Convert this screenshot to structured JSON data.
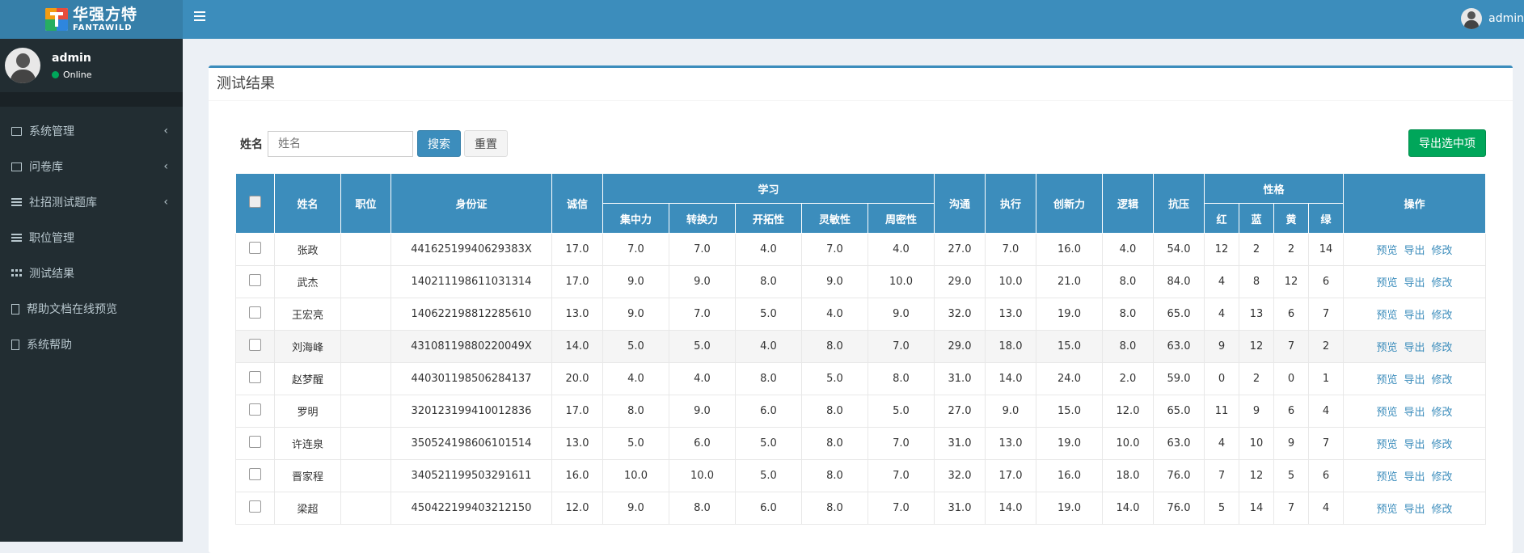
{
  "app": {
    "logo_cn": "华强方特",
    "logo_en": "FANTAWILD"
  },
  "header": {
    "username": "admin"
  },
  "sidebar": {
    "user": {
      "name": "admin",
      "status": "Online"
    },
    "items": [
      {
        "label": "系统管理",
        "icon": "edit-icon",
        "has_children": true
      },
      {
        "label": "问卷库",
        "icon": "book-icon",
        "has_children": true
      },
      {
        "label": "社招测试题库",
        "icon": "list-icon",
        "has_children": true
      },
      {
        "label": "职位管理",
        "icon": "list-icon",
        "has_children": false
      },
      {
        "label": "测试结果",
        "icon": "grid-icon",
        "has_children": false
      },
      {
        "label": "帮助文档在线预览",
        "icon": "file-icon",
        "has_children": false
      },
      {
        "label": "系统帮助",
        "icon": "file-icon",
        "has_children": false
      }
    ]
  },
  "page": {
    "title": "测试结果",
    "search_label": "姓名",
    "search_placeholder": "姓名",
    "search_button": "搜索",
    "reset_button": "重置",
    "export_button": "导出选中项"
  },
  "table": {
    "headers": {
      "name": "姓名",
      "position": "职位",
      "id_card": "身份证",
      "integrity": "诚信",
      "study": "学习",
      "study_sub": [
        "集中力",
        "转换力",
        "开拓性",
        "灵敏性",
        "周密性"
      ],
      "communication": "沟通",
      "execution": "执行",
      "innovation": "创新力",
      "logic": "逻辑",
      "stress": "抗压",
      "personality": "性格",
      "personality_sub": [
        "红",
        "蓝",
        "黄",
        "绿"
      ],
      "actions": "操作"
    },
    "action_labels": [
      "预览",
      "导出",
      "修改"
    ],
    "rows": [
      {
        "name": "张政",
        "position": "",
        "id": "44162519940629383X",
        "vals": [
          "17.0",
          "7.0",
          "7.0",
          "4.0",
          "7.0",
          "4.0",
          "27.0",
          "7.0",
          "16.0",
          "4.0",
          "54.0"
        ],
        "colors": [
          "12",
          "2",
          "2",
          "14"
        ]
      },
      {
        "name": "武杰",
        "position": "",
        "id": "140211198611031314",
        "vals": [
          "17.0",
          "9.0",
          "9.0",
          "8.0",
          "9.0",
          "10.0",
          "29.0",
          "10.0",
          "21.0",
          "8.0",
          "84.0"
        ],
        "colors": [
          "4",
          "8",
          "12",
          "6"
        ]
      },
      {
        "name": "王宏亮",
        "position": "",
        "id": "140622198812285610",
        "vals": [
          "13.0",
          "9.0",
          "7.0",
          "5.0",
          "4.0",
          "9.0",
          "32.0",
          "13.0",
          "19.0",
          "8.0",
          "65.0"
        ],
        "colors": [
          "4",
          "13",
          "6",
          "7"
        ]
      },
      {
        "name": "刘海峰",
        "position": "",
        "id": "43108119880220049X",
        "vals": [
          "14.0",
          "5.0",
          "5.0",
          "4.0",
          "8.0",
          "7.0",
          "29.0",
          "18.0",
          "15.0",
          "8.0",
          "63.0"
        ],
        "colors": [
          "9",
          "12",
          "7",
          "2"
        ]
      },
      {
        "name": "赵梦醒",
        "position": "",
        "id": "440301198506284137",
        "vals": [
          "20.0",
          "4.0",
          "4.0",
          "8.0",
          "5.0",
          "8.0",
          "31.0",
          "14.0",
          "24.0",
          "2.0",
          "59.0"
        ],
        "colors": [
          "0",
          "2",
          "0",
          "1"
        ]
      },
      {
        "name": "罗明",
        "position": "",
        "id": "320123199410012836",
        "vals": [
          "17.0",
          "8.0",
          "9.0",
          "6.0",
          "8.0",
          "5.0",
          "27.0",
          "9.0",
          "15.0",
          "12.0",
          "65.0"
        ],
        "colors": [
          "11",
          "9",
          "6",
          "4"
        ]
      },
      {
        "name": "许连泉",
        "position": "",
        "id": "350524198606101514",
        "vals": [
          "13.0",
          "5.0",
          "6.0",
          "5.0",
          "8.0",
          "7.0",
          "31.0",
          "13.0",
          "19.0",
          "10.0",
          "63.0"
        ],
        "colors": [
          "4",
          "10",
          "9",
          "7"
        ]
      },
      {
        "name": "晋家程",
        "position": "",
        "id": "340521199503291611",
        "vals": [
          "16.0",
          "10.0",
          "10.0",
          "5.0",
          "8.0",
          "7.0",
          "32.0",
          "17.0",
          "16.0",
          "18.0",
          "76.0"
        ],
        "colors": [
          "7",
          "12",
          "5",
          "6"
        ]
      },
      {
        "name": "梁超",
        "position": "",
        "id": "450422199403212150",
        "vals": [
          "12.0",
          "9.0",
          "8.0",
          "6.0",
          "8.0",
          "7.0",
          "31.0",
          "14.0",
          "19.0",
          "14.0",
          "76.0"
        ],
        "colors": [
          "5",
          "14",
          "7",
          "4"
        ]
      }
    ]
  }
}
